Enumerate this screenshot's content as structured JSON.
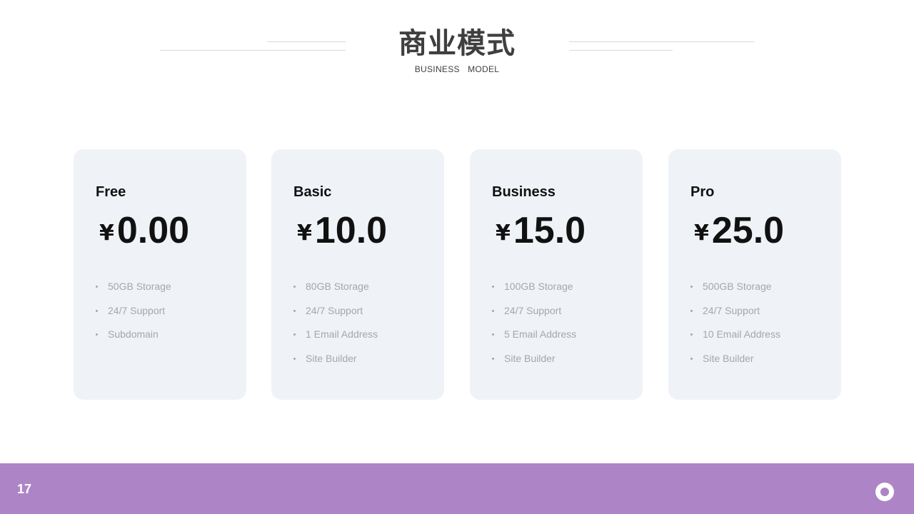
{
  "header": {
    "title": "商业模式",
    "subtitle": "BUSINESS  MODEL"
  },
  "plans": [
    {
      "name": "Free",
      "currency": "¥",
      "price": "0.00",
      "features": [
        "50GB Storage",
        "24/7 Support",
        "Subdomain"
      ]
    },
    {
      "name": "Basic",
      "currency": "¥",
      "price": "10.0",
      "features": [
        "80GB Storage",
        "24/7 Support",
        "1 Email Address",
        "Site Builder"
      ]
    },
    {
      "name": "Business",
      "currency": "¥",
      "price": "15.0",
      "features": [
        "100GB Storage",
        "24/7 Support",
        "5 Email Address",
        "Site Builder"
      ]
    },
    {
      "name": "Pro",
      "currency": "¥",
      "price": "25.0",
      "features": [
        "500GB Storage",
        "24/7 Support",
        "10 Email Address",
        "Site Builder"
      ]
    }
  ],
  "footer": {
    "page_number": "17",
    "icon": "ring-icon"
  },
  "colors": {
    "accent": "#ad85c6",
    "card_bg": "#eff3f7",
    "feature_text": "#a6a6a6"
  }
}
